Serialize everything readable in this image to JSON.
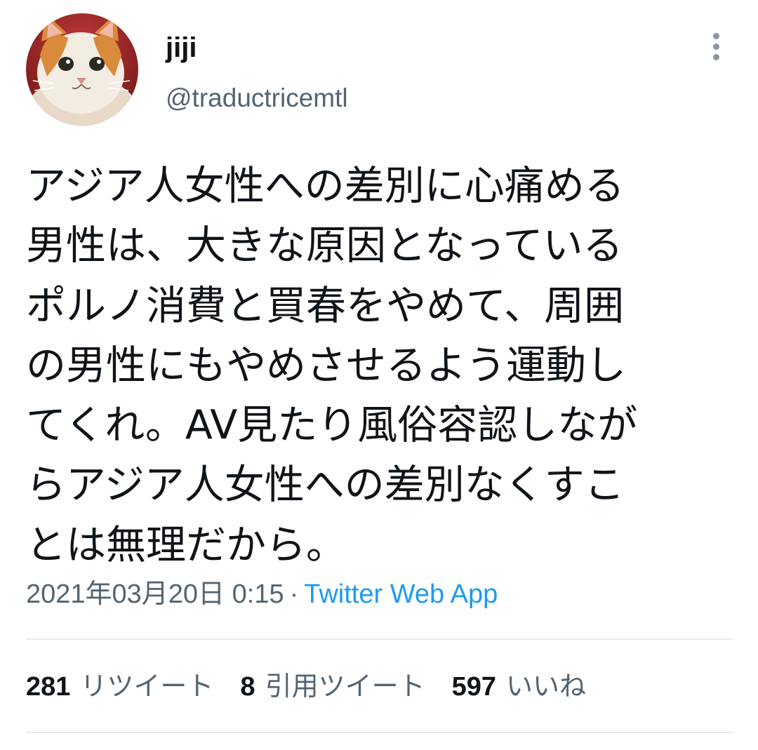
{
  "user": {
    "display_name": "jiji",
    "handle": "@traductricemtl",
    "avatar_icon": "kitten-avatar"
  },
  "tweet": {
    "text": "アジア人女性への差別に心痛める\n男性は、大きな原因となっている\nポルノ消費と買春をやめて、周囲\nの男性にもやめさせるよう運動し\nてくれ。AV見たり風俗容認しなが\nらアジア人女性への差別なくすこ\nとは無理だから。",
    "timestamp": "2021年03月20日 0:15",
    "separator": "·",
    "source": "Twitter Web App"
  },
  "stats": {
    "retweets_count": "281",
    "retweets_label": "リツイート",
    "quotes_count": "8",
    "quotes_label": "引用ツイート",
    "likes_count": "597",
    "likes_label": "いいね"
  },
  "colors": {
    "text": "#0f1419",
    "secondary": "#536471",
    "link": "#1d9bf0",
    "divider": "#e6e9eb"
  }
}
